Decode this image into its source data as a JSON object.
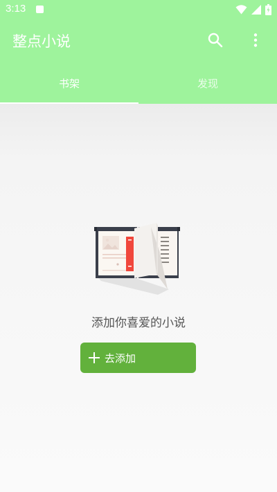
{
  "status_bar": {
    "time": "3:13"
  },
  "app_bar": {
    "title": "整点小说"
  },
  "tabs": [
    {
      "label": "书架",
      "selected": true
    },
    {
      "label": "发现",
      "selected": false
    }
  ],
  "empty_state": {
    "message": "添加你喜爱的小说",
    "button_label": "去添加"
  },
  "colors": {
    "app_bar": "#9ef39c",
    "button": "#62b13c",
    "bookmark": "#f0473c"
  }
}
